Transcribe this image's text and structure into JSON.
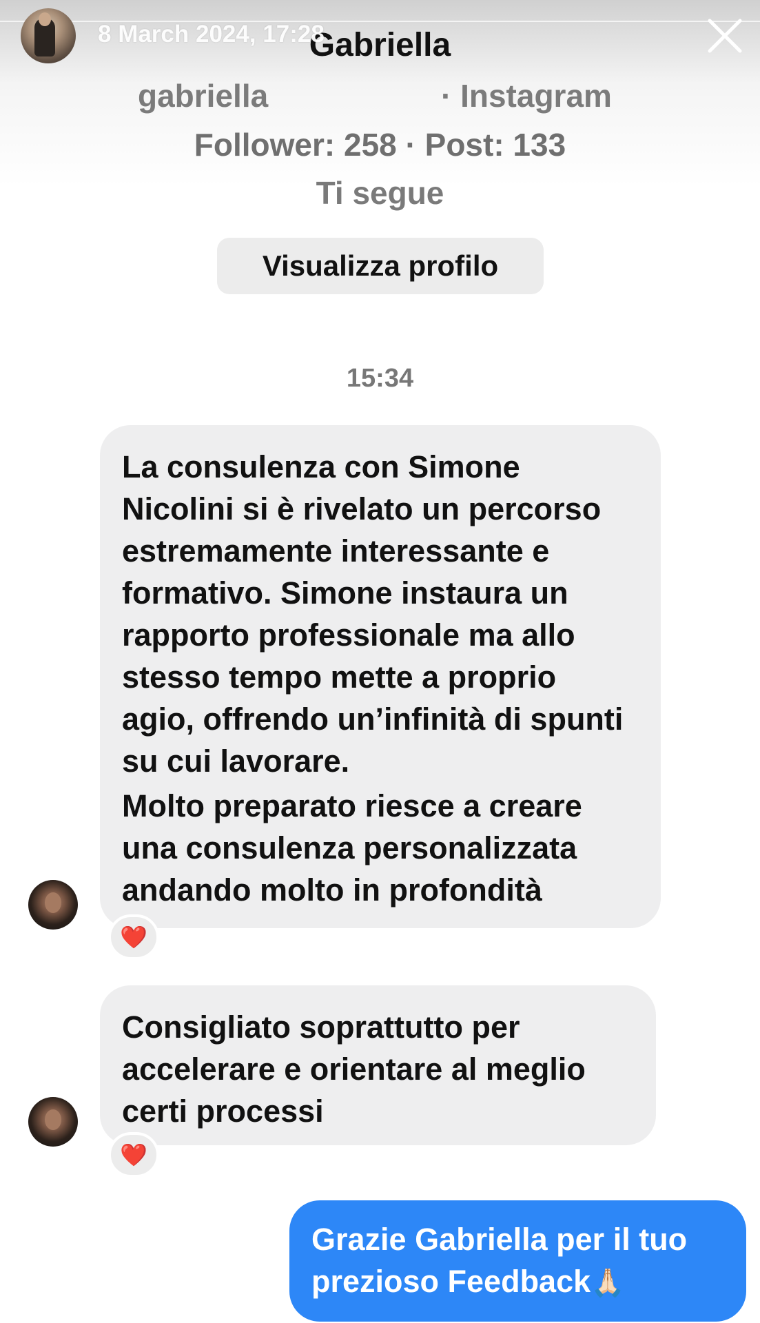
{
  "story": {
    "date": "8 March 2024, 17:28",
    "icons": {
      "avatar": "story-avatar",
      "close": "close-icon"
    }
  },
  "profile": {
    "name": "Gabriella",
    "handle": "gabriella",
    "platform": "· Instagram",
    "stats": "Follower: 258 · Post: 133",
    "follows_you": "Ti segue",
    "view_profile_label": "Visualizza profilo"
  },
  "chat": {
    "timestamp": "15:34",
    "messages": [
      {
        "direction": "incoming",
        "paragraphs": [
          "La consulenza con Simone Nicolini si è rivelato un percorso estremamente interessante e formativo. Simone instaura un rapporto professionale ma allo stesso tempo mette a proprio agio, offrendo un’infinità di spunti su cui lavorare.",
          "Molto preparato riesce a creare una consulenza personalizzata andando molto in profondità"
        ],
        "reaction": "❤️"
      },
      {
        "direction": "incoming",
        "paragraphs": [
          "Consigliato soprattutto per accelerare e orientare al meglio certi processi"
        ],
        "reaction": "❤️"
      },
      {
        "direction": "outgoing",
        "text": "Grazie Gabriella per il tuo prezioso Feedback",
        "emoji": "🙏🏻"
      }
    ]
  },
  "colors": {
    "outgoing_bubble": "#2d87f7",
    "incoming_bubble": "#eeeeef",
    "reaction_heart": "#e0243b"
  }
}
